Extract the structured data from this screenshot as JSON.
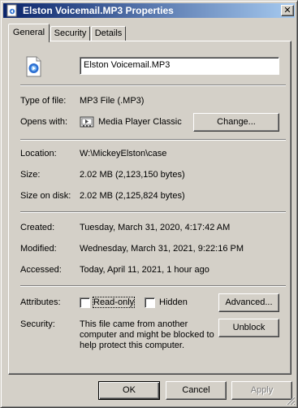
{
  "window": {
    "title": "Elston Voicemail.MP3 Properties",
    "close_glyph": "✕"
  },
  "tabs": [
    {
      "label": "General",
      "active": true
    },
    {
      "label": "Security",
      "active": false
    },
    {
      "label": "Details",
      "active": false
    }
  ],
  "general": {
    "file_icon": "mp3-file-icon",
    "file_name": "Elston Voicemail.MP3",
    "type_label": "Type of file:",
    "type_value": "MP3 File (.MP3)",
    "opens_label": "Opens with:",
    "opens_app_icon": "media-player-classic-icon",
    "opens_value": "Media Player Classic",
    "change_button": "Change...",
    "location_label": "Location:",
    "location_value": "W:\\MickeyElston\\case",
    "size_label": "Size:",
    "size_value": "2.02 MB (2,123,150 bytes)",
    "size_on_disk_label": "Size on disk:",
    "size_on_disk_value": "2.02 MB (2,125,824 bytes)",
    "created_label": "Created:",
    "created_value": "Tuesday, March 31, 2020, 4:17:42 AM",
    "modified_label": "Modified:",
    "modified_value": "Wednesday, March 31, 2021, 9:22:16 PM",
    "accessed_label": "Accessed:",
    "accessed_value": "Today, April 11, 2021, 1 hour ago",
    "attributes_label": "Attributes:",
    "readonly_label": "Read-only",
    "readonly_checked": false,
    "hidden_label": "Hidden",
    "hidden_checked": false,
    "advanced_button": "Advanced...",
    "security_label": "Security:",
    "security_text_1": "This file came from another",
    "security_text_2": "computer and might be blocked to",
    "security_text_3": "help protect this computer.",
    "unblock_button": "Unblock"
  },
  "footer": {
    "ok_button": "OK",
    "cancel_button": "Cancel",
    "apply_button": "Apply",
    "apply_disabled": true
  },
  "colors": {
    "face": "#d4d0c8",
    "title_start": "#0a246a",
    "title_end": "#a6caf0"
  }
}
